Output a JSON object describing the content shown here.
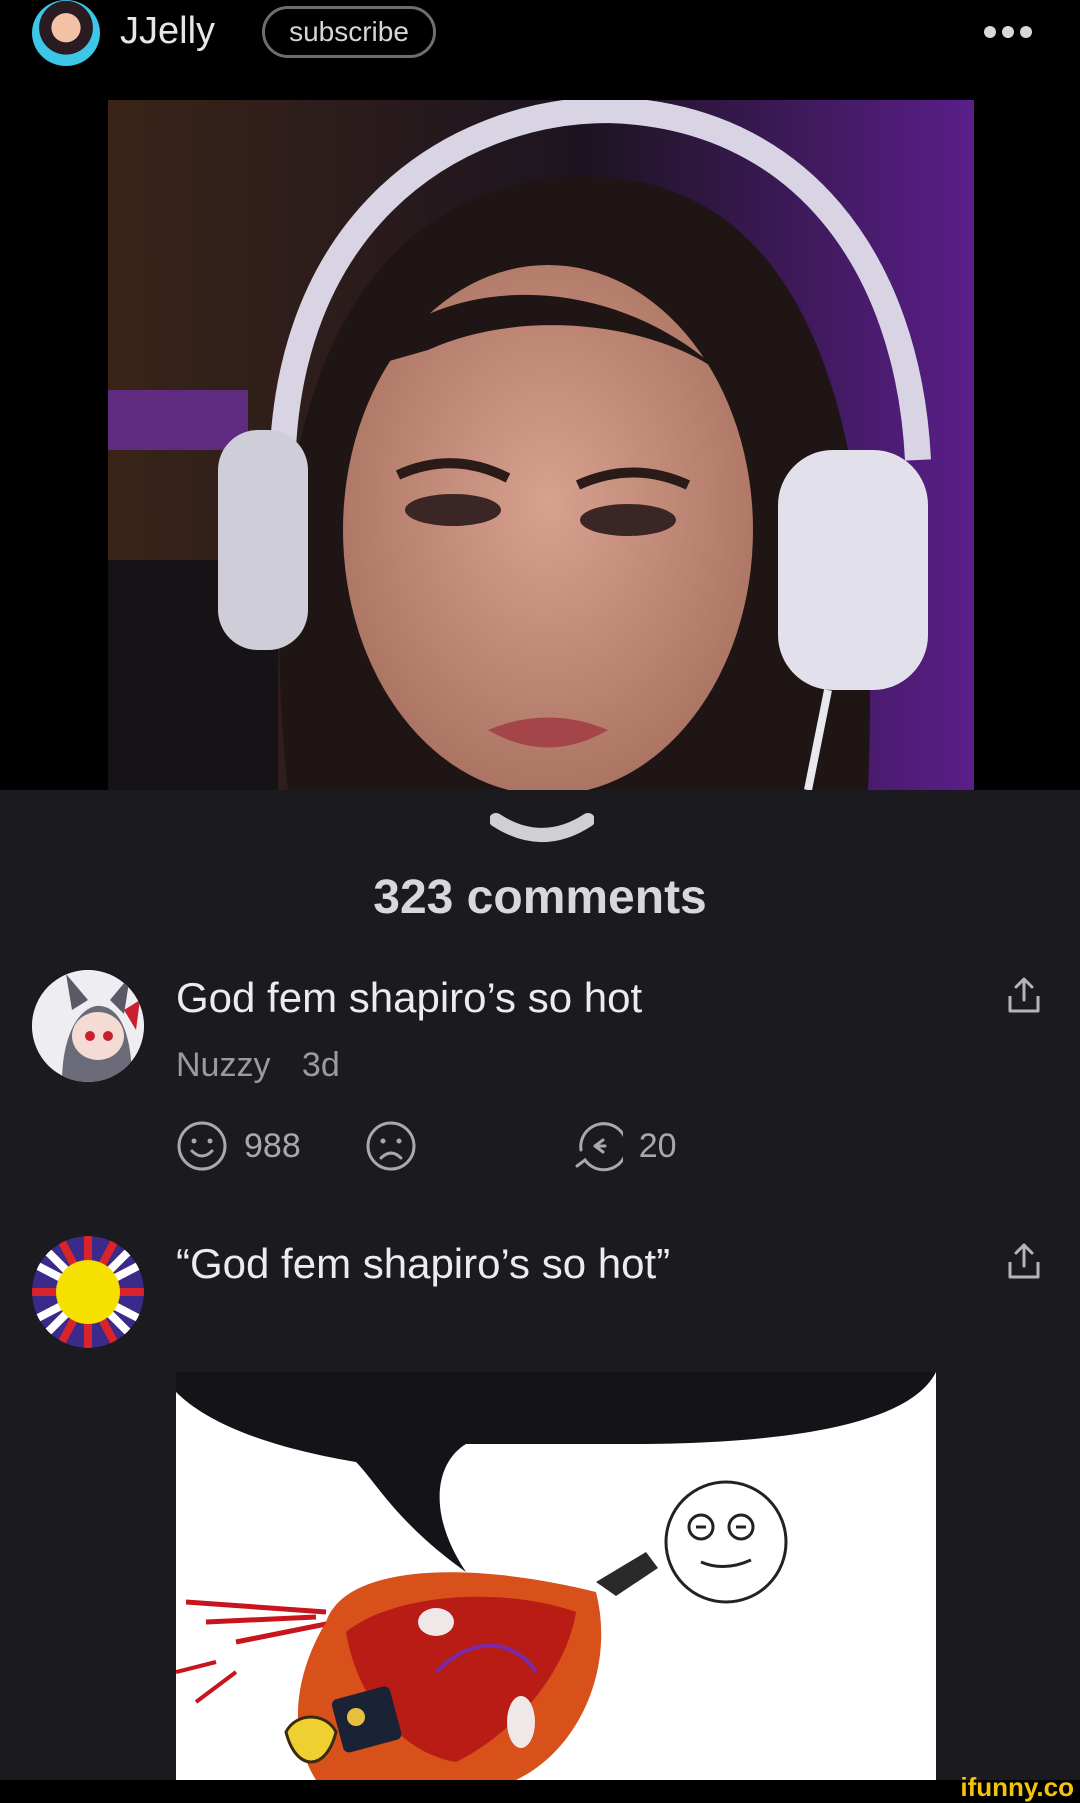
{
  "header": {
    "username": "JJelly",
    "subscribe_label": "subscribe",
    "more_icon": "more-horizontal-icon"
  },
  "comments_header": {
    "count_label": "323 comments",
    "collapse_icon": "chevron-down-icon"
  },
  "comments": [
    {
      "text": "God fem shapiro’s so hot",
      "author": "Nuzzy",
      "age": "3d",
      "smile_count": "988",
      "reply_count": "20"
    },
    {
      "text": "“God fem shapiro’s so hot”"
    }
  ],
  "watermark": "ifunny.co",
  "colors": {
    "background": "#000000",
    "panel": "#1b1a1f",
    "text_primary": "#ececf0",
    "text_secondary": "#9a9aa0",
    "watermark": "#f4c20d"
  }
}
